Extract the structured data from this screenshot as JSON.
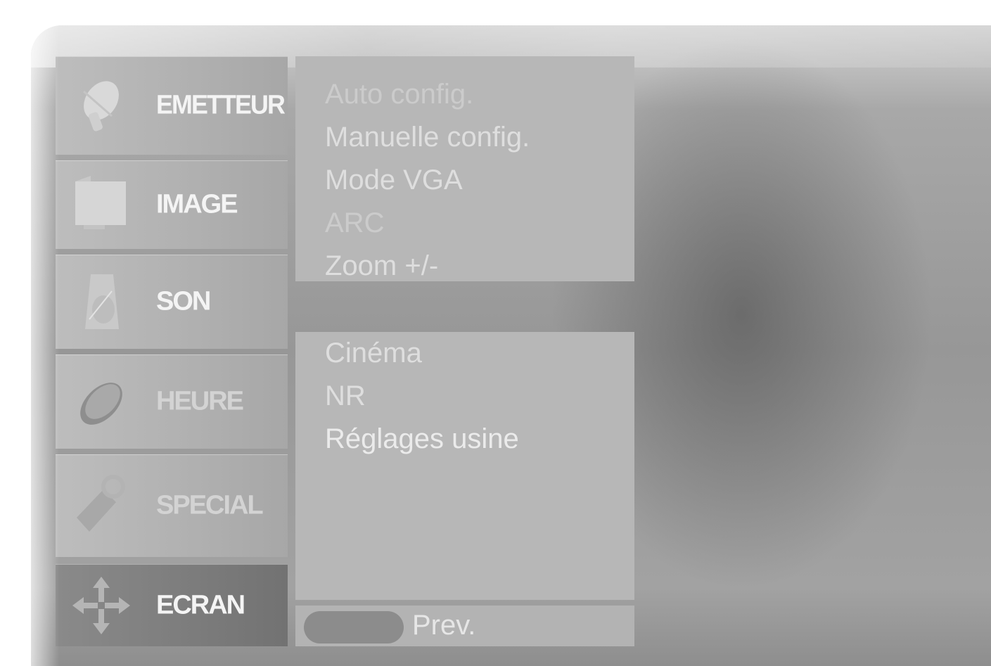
{
  "menu": {
    "categories": [
      {
        "label": "EMETTEUR",
        "icon": "satellite-dish-icon"
      },
      {
        "label": "IMAGE",
        "icon": "picture-icon"
      },
      {
        "label": "SON",
        "icon": "speaker-icon"
      },
      {
        "label": "HEURE",
        "icon": "clock-icon"
      },
      {
        "label": "SPECIAL",
        "icon": "key-tag-icon"
      },
      {
        "label": "ECRAN",
        "icon": "move-arrows-icon"
      }
    ],
    "selected": "ECRAN"
  },
  "screen_menu": {
    "items_top": [
      "Auto config.",
      "Manuelle config.",
      "Mode VGA",
      "ARC",
      "Zoom +/-"
    ],
    "items_bottom": [
      "Cinéma",
      "NR",
      "Réglages usine"
    ]
  },
  "footer": {
    "prev_label": "Prev."
  },
  "colors": {
    "selected_category": "#7c7c7c",
    "panel": "#b7b7b7",
    "text": "#ebebeb"
  }
}
